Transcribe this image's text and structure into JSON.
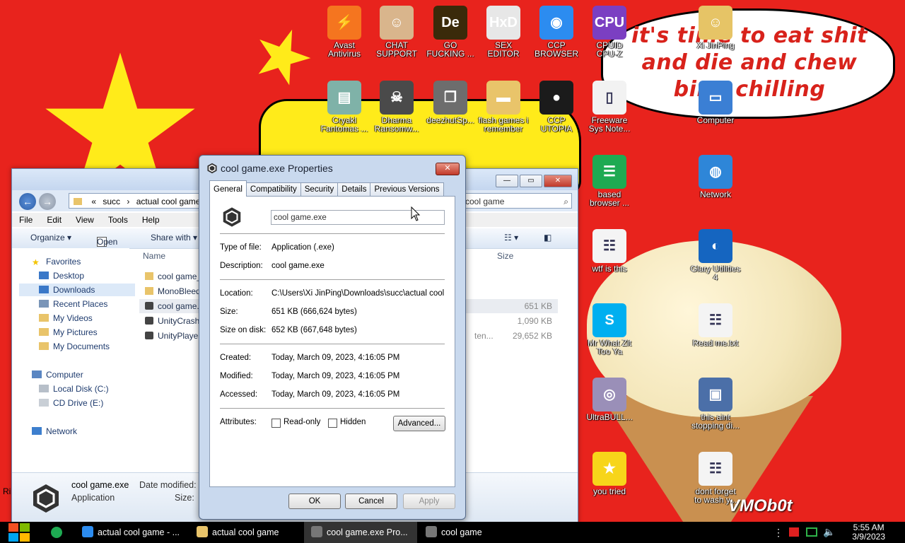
{
  "colors": {
    "flag_red": "#e8231d",
    "flag_yellow": "#ffeb1a",
    "speech_text": "#d8221b",
    "titlebar_blue": "#c4d6ef"
  },
  "speech": {
    "text": "it's time to eat shit and die and chew bing chilling"
  },
  "watermark": "VMOb0t",
  "desktop_icons": [
    {
      "label": "Avast\nAntivirus",
      "icon": "avast-icon",
      "color": "#f5751f"
    },
    {
      "label": "CHAT\nSUPPORT",
      "icon": "doctor-icon",
      "color": "#d9b58c"
    },
    {
      "label": "GO\nFUCKING ...",
      "icon": "de-icon",
      "color": "#3a2a0a"
    },
    {
      "label": "SEX\nEDITOR",
      "icon": "hxd-icon",
      "color": "#e7e7e7"
    },
    {
      "label": "CCP\nBROWSER",
      "icon": "chrome-icon",
      "color": "#2c8cf0"
    },
    {
      "label": "CPUID\nCPU-Z",
      "icon": "cpuz-icon",
      "color": "#7b3fc2"
    },
    {
      "label": "Xi JinPing",
      "icon": "user-folder-icon",
      "color": "#e6c466"
    },
    {
      "label": "Cryakl\nFantomas ...",
      "icon": "window-icon",
      "color": "#7fb2a8"
    },
    {
      "label": "Dharma\nRansomw...",
      "icon": "skull-icon",
      "color": "#4a4a4a"
    },
    {
      "label": "deezhutSp...",
      "icon": "copy-icon",
      "color": "#6d6d6d"
    },
    {
      "label": "flash games i\nremember",
      "icon": "folder-icon",
      "color": "#e9c46a"
    },
    {
      "label": "CCP\nUTOPIA",
      "icon": "record-icon",
      "color": "#1b1b1b"
    },
    {
      "label": "Freeware\nSys Note...",
      "icon": "document-icon",
      "color": "#f2f2f2"
    },
    {
      "label": "Computer",
      "icon": "computer-icon",
      "color": "#3b7fd4"
    },
    {
      "label": "based\nbrowser ...",
      "icon": "sheets-icon",
      "color": "#1eaa52"
    },
    {
      "label": "Network",
      "icon": "network-icon",
      "color": "#2e86d8"
    },
    {
      "label": "wtf is this",
      "icon": "text-file-icon",
      "color": "#f4f4f4"
    },
    {
      "label": "Glary Utilities\n4",
      "icon": "glary-icon",
      "color": "#1565c0"
    },
    {
      "label": "Mr What Zit\nToo Ya",
      "icon": "skype-icon",
      "color": "#00aff0"
    },
    {
      "label": "Read me.txt",
      "icon": "text-file-icon",
      "color": "#f4f4f4"
    },
    {
      "label": "UltraBULL...",
      "icon": "disc-icon",
      "color": "#9a8fb8"
    },
    {
      "label": "this aint\nstopping di...",
      "icon": "scan-icon",
      "color": "#4b6fa8"
    },
    {
      "label": "you tried",
      "icon": "star-icon",
      "color": "#f7d51a"
    },
    {
      "label": "dont forget\nto wash y...",
      "icon": "text-file-icon",
      "color": "#f4f4f4"
    }
  ],
  "explorer": {
    "address": [
      "«",
      "succ",
      "›",
      "actual cool game",
      "›"
    ],
    "search_placeholder": "cool game",
    "menu": [
      "File",
      "Edit",
      "View",
      "Tools",
      "Help"
    ],
    "toolbar": {
      "organize": "Organize ▾",
      "open": "Open",
      "share": "Share with ▾"
    },
    "nav": {
      "favorites": "Favorites",
      "desktop": "Desktop",
      "downloads": "Downloads",
      "recent": "Recent Places",
      "videos": "My Videos",
      "pictures": "My Pictures",
      "documents": "My Documents",
      "computer": "Computer",
      "local_disk": "Local Disk (C:)",
      "cd_drive": "CD Drive (E:)",
      "network": "Network"
    },
    "columns": {
      "name": "Name",
      "size": "Size"
    },
    "files": [
      {
        "name": "cool game_",
        "size": "",
        "type": ""
      },
      {
        "name": "MonoBleed",
        "size": "",
        "type": ""
      },
      {
        "name": "cool game.",
        "size": "651 KB",
        "type": ""
      },
      {
        "name": "UnityCrash",
        "size": "1,090 KB",
        "type": ""
      },
      {
        "name": "UnityPlayer",
        "size": "29,652 KB",
        "type": "ten..."
      }
    ],
    "details": {
      "name": "cool game.exe",
      "type": "Application",
      "modified_label": "Date modified:",
      "size_label": "Size:"
    },
    "partial_left_char": "Ri"
  },
  "properties": {
    "title": "cool game.exe Properties",
    "tabs": [
      "General",
      "Compatibility",
      "Security",
      "Details",
      "Previous Versions"
    ],
    "name_value": "cool game.exe",
    "type_label": "Type of file:",
    "type_value": "Application (.exe)",
    "desc_label": "Description:",
    "desc_value": "cool game.exe",
    "location_label": "Location:",
    "location_value": "C:\\Users\\Xi JinPing\\Downloads\\succ\\actual cool game",
    "size_label": "Size:",
    "size_value": "651 KB (666,624 bytes)",
    "sizedisk_label": "Size on disk:",
    "sizedisk_value": "652 KB (667,648 bytes)",
    "created_label": "Created:",
    "created_value": "Today, March 09, 2023, 4:16:05 PM",
    "modified_label": "Modified:",
    "modified_value": "Today, March 09, 2023, 4:16:05 PM",
    "accessed_label": "Accessed:",
    "accessed_value": "Today, March 09, 2023, 4:16:05 PM",
    "attributes_label": "Attributes:",
    "readonly_label": "Read-only",
    "hidden_label": "Hidden",
    "advanced_label": "Advanced...",
    "ok_label": "OK",
    "cancel_label": "Cancel",
    "apply_label": "Apply"
  },
  "taskbar": {
    "items": [
      {
        "label": "actual cool game - ...",
        "icon": "chrome-icon"
      },
      {
        "label": "actual cool game",
        "icon": "folder-icon"
      },
      {
        "label": "cool game.exe Pro...",
        "icon": "unity-icon"
      },
      {
        "label": "cool game",
        "icon": "unity-icon"
      }
    ],
    "time": "5:55 AM",
    "date": "3/9/2023"
  }
}
